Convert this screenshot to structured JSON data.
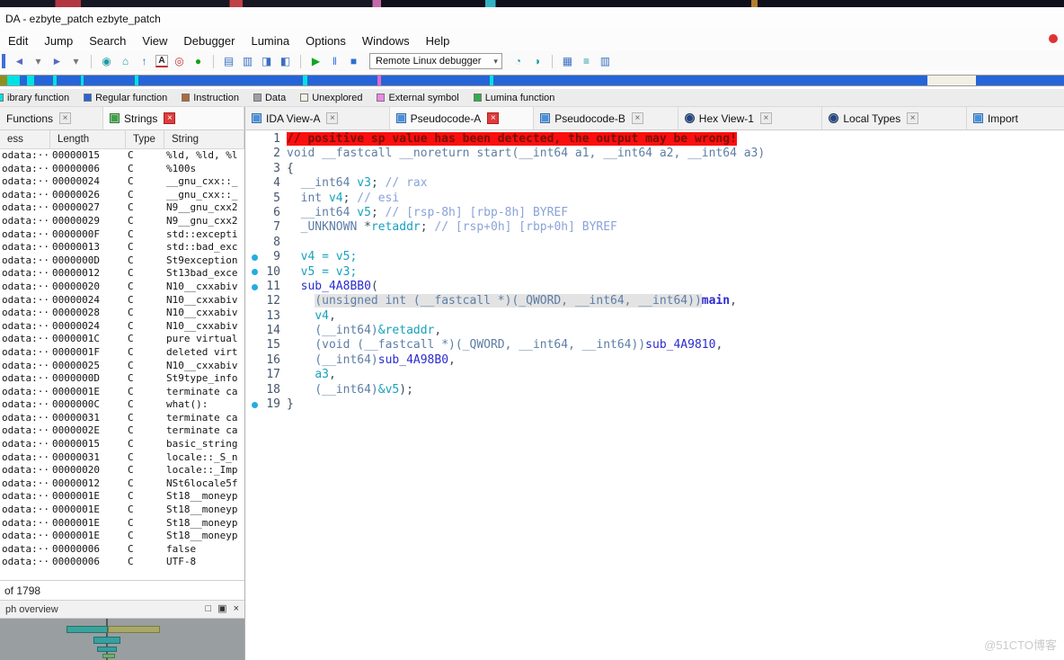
{
  "window": {
    "title": "DA - ezbyte_patch ezbyte_patch"
  },
  "menubar": {
    "items": [
      "Edit",
      "Jump",
      "Search",
      "View",
      "Debugger",
      "Lumina",
      "Options",
      "Windows",
      "Help"
    ]
  },
  "toolbar": {
    "debugger_combo": "Remote Linux debugger",
    "left_groups": [
      [
        {
          "name": "back-arrow-icon",
          "g": "◄",
          "c": "#5a68c8"
        },
        {
          "name": "back-history-caret-icon",
          "g": "▾",
          "c": "#777"
        },
        {
          "name": "forward-arrow-icon",
          "g": "►",
          "c": "#5a68c8"
        },
        {
          "name": "forward-history-caret-icon",
          "g": "▾",
          "c": "#777"
        }
      ],
      [
        {
          "name": "jump-target-icon",
          "g": "◉",
          "c": "#1a9aa0"
        },
        {
          "name": "home-icon",
          "g": "⌂",
          "c": "#1a9aa0"
        },
        {
          "name": "jump-up-icon",
          "g": "↑",
          "c": "#2f6fd0"
        },
        {
          "name": "rename-icon",
          "g": "A",
          "c": "#222",
          "box": true
        },
        {
          "name": "color-target-icon",
          "g": "◎",
          "c": "#c23434"
        },
        {
          "name": "lumina-icon",
          "g": "●",
          "c": "#18a018"
        }
      ],
      [
        {
          "name": "debug-windows-icon",
          "g": "▤",
          "c": "#3a6fc0"
        },
        {
          "name": "registers-icon",
          "g": "▥",
          "c": "#3a6fc0"
        },
        {
          "name": "stack-view-icon",
          "g": "◨",
          "c": "#3a6fc0"
        },
        {
          "name": "breakpoint-list-icon",
          "g": "◧",
          "c": "#3a6fc0"
        }
      ],
      [
        {
          "name": "start-process-icon",
          "g": "▶",
          "c": "#12a521"
        },
        {
          "name": "pause-process-icon",
          "g": "‖",
          "c": "#2f6fd0"
        },
        {
          "name": "stop-process-icon",
          "g": "■",
          "c": "#2f6fd0"
        }
      ]
    ],
    "right_groups": [
      [
        {
          "name": "attach-process-icon",
          "g": "◔",
          "c": "#1a9aa0"
        },
        {
          "name": "trace-icon",
          "g": "◑",
          "c": "#1a9aa0"
        }
      ],
      [
        {
          "name": "open-windows-icon",
          "g": "▦",
          "c": "#3a6fc0"
        },
        {
          "name": "segments-icon",
          "g": "≡",
          "c": "#1a9aa0"
        },
        {
          "name": "layout-icon",
          "g": "▥",
          "c": "#3a6fc0"
        }
      ]
    ]
  },
  "navband": {
    "segments": [
      {
        "c": "#8f8f1e",
        "w": 0.7
      },
      {
        "c": "#00e2e2",
        "w": 1.2
      },
      {
        "c": "#2565d8",
        "w": 0.6
      },
      {
        "c": "#00e2e2",
        "w": 0.7
      },
      {
        "c": "#2565d8",
        "w": 1.8
      },
      {
        "c": "#00e2e2",
        "w": 0.3
      },
      {
        "c": "#2565d8",
        "w": 2.3
      },
      {
        "c": "#00e2e2",
        "w": 0.3
      },
      {
        "c": "#2565d8",
        "w": 4.8
      },
      {
        "c": "#00e2e2",
        "w": 0.3
      },
      {
        "c": "#2565d8",
        "w": 15.5
      },
      {
        "c": "#00e2e2",
        "w": 0.4
      },
      {
        "c": "#2565d8",
        "w": 6.6
      },
      {
        "c": "#e668c8",
        "w": 0.3
      },
      {
        "c": "#2565d8",
        "w": 10.2
      },
      {
        "c": "#00e2e2",
        "w": 0.4
      },
      {
        "c": "#2565d8",
        "w": 40.8
      },
      {
        "c": "#f2f0e4",
        "w": 4.5
      },
      {
        "c": "#2565d8",
        "w": 8.3
      }
    ]
  },
  "legend": {
    "items": [
      {
        "label": "ibrary function",
        "color": "#00e2e2"
      },
      {
        "label": "Regular function",
        "color": "#2565d8"
      },
      {
        "label": "Instruction",
        "color": "#b06a35"
      },
      {
        "label": "Data",
        "color": "#9aa0a6"
      },
      {
        "label": "Unexplored",
        "color": "#f2f0e4"
      },
      {
        "label": "External symbol",
        "color": "#ef86e8"
      },
      {
        "label": "Lumina function",
        "color": "#2fae4a"
      }
    ]
  },
  "tabs": {
    "left": [
      {
        "label": "Functions",
        "icon": null,
        "icon_color": null,
        "close": "gray",
        "active": false
      },
      {
        "label": "Strings",
        "icon": "square",
        "icon_color": "#43a047",
        "close": "red",
        "active": true
      }
    ],
    "right": [
      {
        "label": "IDA View-A",
        "icon": "square",
        "icon_color": "#4a90d9",
        "close": "gray",
        "active": false
      },
      {
        "label": "Pseudocode-A",
        "icon": "square",
        "icon_color": "#4a90d9",
        "close": "red",
        "active": true
      },
      {
        "label": "Pseudocode-B",
        "icon": "square",
        "icon_color": "#4a90d9",
        "close": "gray",
        "active": false
      },
      {
        "label": "Hex View-1",
        "icon": "circle",
        "icon_color": "#24467e",
        "close": "gray",
        "active": false
      },
      {
        "label": "Local Types",
        "icon": "circle",
        "icon_color": "#24467e",
        "close": "gray",
        "active": false
      },
      {
        "label": "Import",
        "icon": "square",
        "icon_color": "#4a90d9",
        "close": "none",
        "active": false
      }
    ]
  },
  "strings_panel": {
    "columns": [
      "ess",
      "Length",
      "Type",
      "String"
    ],
    "rows": [
      [
        "odata:···",
        "00000015",
        "C",
        "%ld, %ld, %l"
      ],
      [
        "odata:···",
        "00000006",
        "C",
        "%100s"
      ],
      [
        "odata:···",
        "00000024",
        "C",
        "__gnu_cxx::_"
      ],
      [
        "odata:···",
        "00000026",
        "C",
        "__gnu_cxx::_"
      ],
      [
        "odata:···",
        "00000027",
        "C",
        "N9__gnu_cxx2"
      ],
      [
        "odata:···",
        "00000029",
        "C",
        "N9__gnu_cxx2"
      ],
      [
        "odata:···",
        "0000000F",
        "C",
        "std::excepti"
      ],
      [
        "odata:···",
        "00000013",
        "C",
        "std::bad_exc"
      ],
      [
        "odata:···",
        "0000000D",
        "C",
        "St9exception"
      ],
      [
        "odata:···",
        "00000012",
        "C",
        "St13bad_exce"
      ],
      [
        "odata:···",
        "00000020",
        "C",
        "N10__cxxabiv"
      ],
      [
        "odata:···",
        "00000024",
        "C",
        "N10__cxxabiv"
      ],
      [
        "odata:···",
        "00000028",
        "C",
        "N10__cxxabiv"
      ],
      [
        "odata:···",
        "00000024",
        "C",
        "N10__cxxabiv"
      ],
      [
        "odata:···",
        "0000001C",
        "C",
        "pure virtual"
      ],
      [
        "odata:···",
        "0000001F",
        "C",
        "deleted virt"
      ],
      [
        "odata:···",
        "00000025",
        "C",
        "N10__cxxabiv"
      ],
      [
        "odata:···",
        "0000000D",
        "C",
        "St9type_info"
      ],
      [
        "odata:···",
        "0000001E",
        "C",
        "terminate ca"
      ],
      [
        "odata:···",
        "0000000C",
        "C",
        "what():"
      ],
      [
        "odata:···",
        "00000031",
        "C",
        "terminate ca"
      ],
      [
        "odata:···",
        "0000002E",
        "C",
        "terminate ca"
      ],
      [
        "odata:···",
        "00000015",
        "C",
        "basic_string"
      ],
      [
        "odata:···",
        "00000031",
        "C",
        "locale::_S_n"
      ],
      [
        "odata:···",
        "00000020",
        "C",
        "locale::_Imp"
      ],
      [
        "odata:···",
        "00000012",
        "C",
        "NSt6locale5f"
      ],
      [
        "odata:···",
        "0000001E",
        "C",
        "St18__moneyp"
      ],
      [
        "odata:···",
        "0000001E",
        "C",
        "St18__moneyp"
      ],
      [
        "odata:···",
        "0000001E",
        "C",
        "St18__moneyp"
      ],
      [
        "odata:···",
        "0000001E",
        "C",
        "St18__moneyp"
      ],
      [
        "odata:···",
        "00000006",
        "C",
        "false"
      ],
      [
        "odata:···",
        "00000006",
        "C",
        "UTF-8"
      ]
    ],
    "status": "of 1798"
  },
  "overview": {
    "title": "ph overview",
    "buttons": [
      {
        "name": "maximize-icon",
        "g": "□"
      },
      {
        "name": "float-icon",
        "g": "▣"
      },
      {
        "name": "close-icon",
        "g": "×"
      }
    ]
  },
  "pseudocode": {
    "lines": [
      {
        "n": 1,
        "segs": [
          {
            "t": "// positive sp value has been detected, the output may be wrong!",
            "c": "warn"
          }
        ]
      },
      {
        "n": 2,
        "segs": [
          {
            "t": "void __fastcall __noreturn start(__int64 a1, __int64 a2, __int64 a3)",
            "c": "kw"
          }
        ]
      },
      {
        "n": 3,
        "segs": [
          {
            "t": "{",
            "c": "pl"
          }
        ]
      },
      {
        "n": 4,
        "segs": [
          {
            "t": "  ",
            "c": "pl"
          },
          {
            "t": "__int64 ",
            "c": "kw"
          },
          {
            "t": "v3",
            "c": "lv"
          },
          {
            "t": "; ",
            "c": "pl"
          },
          {
            "t": "// rax",
            "c": "cm"
          }
        ]
      },
      {
        "n": 5,
        "segs": [
          {
            "t": "  ",
            "c": "pl"
          },
          {
            "t": "int ",
            "c": "kw"
          },
          {
            "t": "v4",
            "c": "lv"
          },
          {
            "t": "; ",
            "c": "pl"
          },
          {
            "t": "// esi",
            "c": "cm"
          }
        ]
      },
      {
        "n": 6,
        "segs": [
          {
            "t": "  ",
            "c": "pl"
          },
          {
            "t": "__int64 ",
            "c": "kw"
          },
          {
            "t": "v5",
            "c": "lv"
          },
          {
            "t": "; ",
            "c": "pl"
          },
          {
            "t": "// [rsp-8h] [rbp-8h] BYREF",
            "c": "cm"
          }
        ]
      },
      {
        "n": 7,
        "segs": [
          {
            "t": "  ",
            "c": "pl"
          },
          {
            "t": "_UNKNOWN ",
            "c": "kw"
          },
          {
            "t": "*",
            "c": "pl"
          },
          {
            "t": "retaddr",
            "c": "lv"
          },
          {
            "t": "; ",
            "c": "pl"
          },
          {
            "t": "// [rsp+0h] [rbp+0h] BYREF",
            "c": "cm"
          }
        ]
      },
      {
        "n": 8,
        "segs": []
      },
      {
        "n": 9,
        "bp": true,
        "segs": [
          {
            "t": "  ",
            "c": "pl"
          },
          {
            "t": "v4 = v5;",
            "c": "lv"
          }
        ]
      },
      {
        "n": 10,
        "bp": true,
        "segs": [
          {
            "t": "  ",
            "c": "pl"
          },
          {
            "t": "v5 = v3;",
            "c": "lv"
          }
        ]
      },
      {
        "n": 11,
        "bp": true,
        "segs": [
          {
            "t": "  ",
            "c": "pl"
          },
          {
            "t": "sub_4A8BB0",
            "c": "fn"
          },
          {
            "t": "(",
            "c": "pl"
          }
        ]
      },
      {
        "n": 12,
        "segs": [
          {
            "t": "    ",
            "c": "pl"
          },
          {
            "t": "(unsigned int (__fastcall *)(_QWORD, __int64, __int64))",
            "c": "kw hl"
          },
          {
            "t": "main",
            "c": "fnb"
          },
          {
            "t": ",",
            "c": "pl"
          }
        ]
      },
      {
        "n": 13,
        "segs": [
          {
            "t": "    ",
            "c": "pl"
          },
          {
            "t": "v4",
            "c": "lv"
          },
          {
            "t": ",",
            "c": "pl"
          }
        ]
      },
      {
        "n": 14,
        "segs": [
          {
            "t": "    ",
            "c": "pl"
          },
          {
            "t": "(__int64)",
            "c": "kw"
          },
          {
            "t": "&retaddr",
            "c": "lv"
          },
          {
            "t": ",",
            "c": "pl"
          }
        ]
      },
      {
        "n": 15,
        "segs": [
          {
            "t": "    ",
            "c": "pl"
          },
          {
            "t": "(void (__fastcall *)(_QWORD, __int64, __int64))",
            "c": "kw"
          },
          {
            "t": "sub_4A9810",
            "c": "fn"
          },
          {
            "t": ",",
            "c": "pl"
          }
        ]
      },
      {
        "n": 16,
        "segs": [
          {
            "t": "    ",
            "c": "pl"
          },
          {
            "t": "(__int64)",
            "c": "kw"
          },
          {
            "t": "sub_4A98B0",
            "c": "fn"
          },
          {
            "t": ",",
            "c": "pl"
          }
        ]
      },
      {
        "n": 17,
        "segs": [
          {
            "t": "    ",
            "c": "pl"
          },
          {
            "t": "a3",
            "c": "lv"
          },
          {
            "t": ",",
            "c": "pl"
          }
        ]
      },
      {
        "n": 18,
        "segs": [
          {
            "t": "    ",
            "c": "pl"
          },
          {
            "t": "(__int64)",
            "c": "kw"
          },
          {
            "t": "&v5",
            "c": "lv"
          },
          {
            "t": ");",
            "c": "pl"
          }
        ]
      },
      {
        "n": 19,
        "bp": true,
        "segs": [
          {
            "t": "}",
            "c": "pl"
          }
        ]
      }
    ]
  },
  "watermark": "@51CTO博客"
}
